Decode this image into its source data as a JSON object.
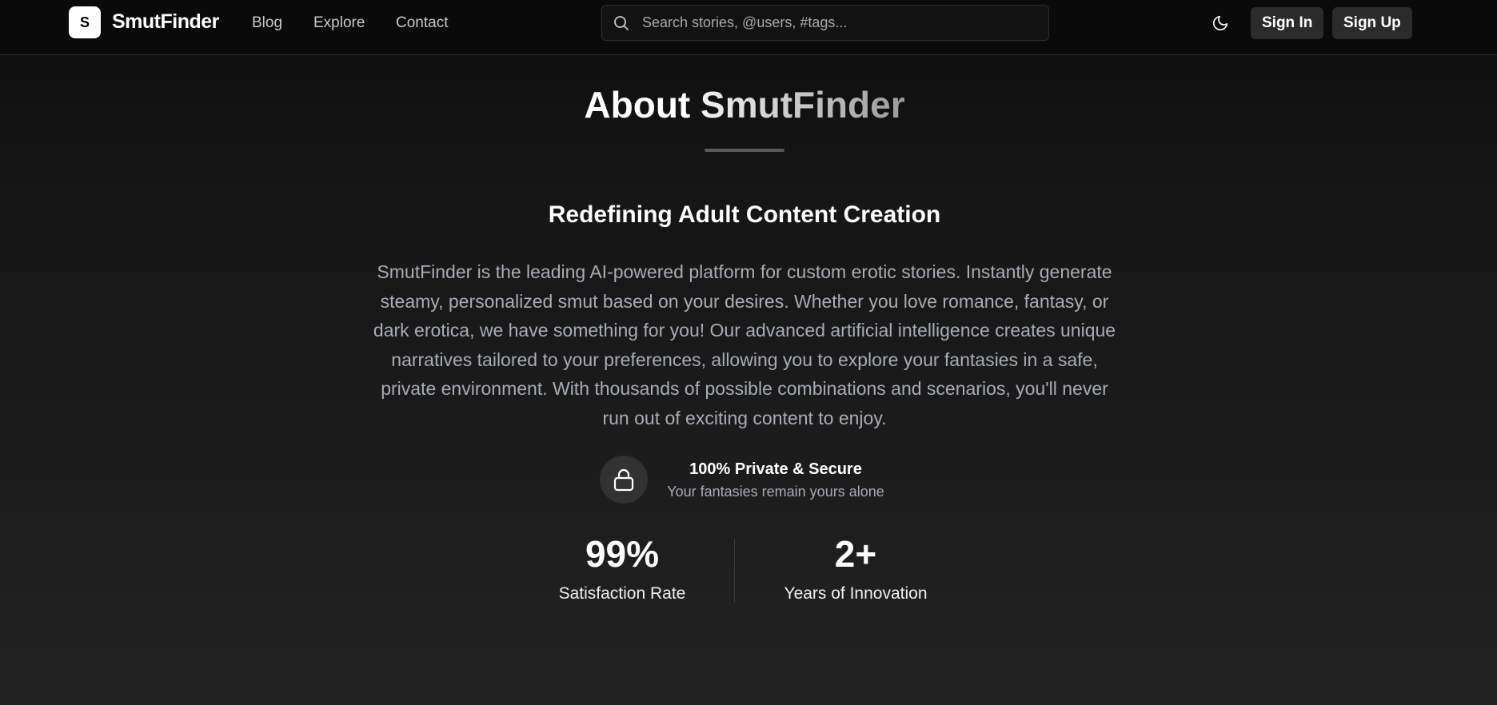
{
  "navbar": {
    "logo_letter": "S",
    "brand": "SmutFinder",
    "links": [
      "Blog",
      "Explore",
      "Contact"
    ],
    "search_placeholder": "Search stories, @users, #tags...",
    "theme_icon": "moon-icon",
    "sign_in_label": "Sign In",
    "sign_up_label": "Sign Up"
  },
  "main": {
    "title_prefix": "About",
    "title_brand": "SmutFinder",
    "subtitle": "Redefining Adult Content Creation",
    "description": "SmutFinder is the leading AI-powered platform for custom erotic stories. Instantly generate steamy, personalized smut based on your desires. Whether you love romance, fantasy, or dark erotica, we have something for you! Our advanced artificial intelligence creates unique narratives tailored to your preferences, allowing you to explore your fantasies in a safe, private environment. With thousands of possible combinations and scenarios, you'll never run out of exciting content to enjoy.",
    "feature": {
      "icon": "lock-icon",
      "title": "100% Private & Secure",
      "description": "Your fantasies remain yours alone"
    },
    "stats": [
      {
        "value": "99%",
        "label": "Satisfaction Rate"
      },
      {
        "value": "2+",
        "label": "Years of Innovation"
      }
    ]
  },
  "colors": {
    "background_top": "#0d0d0d",
    "background_bottom": "#222222",
    "button_bg": "#2b2b2b",
    "muted_text": "#a7acb6"
  }
}
